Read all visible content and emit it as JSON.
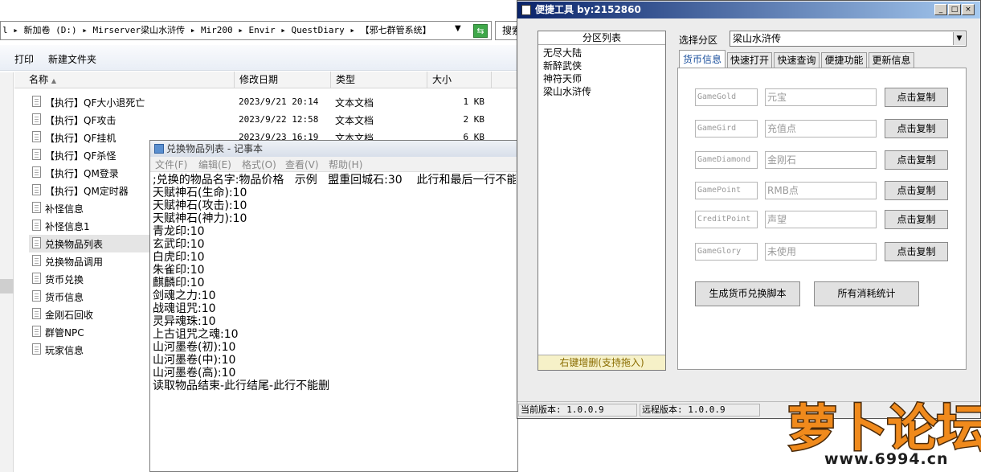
{
  "explorer": {
    "address": "l ▸ 新加卷 (D:) ▸ Mirserver梁山水浒传 ▸ Mir200 ▸ Envir ▸ QuestDiary ▸ 【邪七群管系统】",
    "search_label": "搜索",
    "toolbar": {
      "print": "打印",
      "new_folder": "新建文件夹"
    },
    "columns": {
      "name": "名称",
      "date": "修改日期",
      "type": "类型",
      "size": "大小"
    },
    "files": [
      {
        "name": "【执行】QF大小退死亡",
        "date": "2023/9/21 20:14",
        "type": "文本文档",
        "size": "1 KB"
      },
      {
        "name": "【执行】QF攻击",
        "date": "2023/9/22 12:58",
        "type": "文本文档",
        "size": "2 KB"
      },
      {
        "name": "【执行】QF挂机",
        "date": "2023/9/23 16:19",
        "type": "文本文档",
        "size": "6 KB"
      },
      {
        "name": "【执行】QF杀怪",
        "date": "",
        "type": "",
        "size": ""
      },
      {
        "name": "【执行】QM登录",
        "date": "",
        "type": "",
        "size": ""
      },
      {
        "name": "【执行】QM定时器",
        "date": "",
        "type": "",
        "size": ""
      },
      {
        "name": "补怪信息",
        "date": "",
        "type": "",
        "size": ""
      },
      {
        "name": "补怪信息1",
        "date": "",
        "type": "",
        "size": ""
      },
      {
        "name": "兑换物品列表",
        "date": "",
        "type": "",
        "size": ""
      },
      {
        "name": "兑换物品调用",
        "date": "",
        "type": "",
        "size": ""
      },
      {
        "name": "货币兑换",
        "date": "",
        "type": "",
        "size": ""
      },
      {
        "name": "货币信息",
        "date": "",
        "type": "",
        "size": ""
      },
      {
        "name": "金刚石回收",
        "date": "",
        "type": "",
        "size": ""
      },
      {
        "name": "群管NPC",
        "date": "",
        "type": "",
        "size": ""
      },
      {
        "name": "玩家信息",
        "date": "",
        "type": "",
        "size": ""
      }
    ]
  },
  "notepad": {
    "title": "兑换物品列表 - 记事本",
    "menu": [
      "文件(F)",
      "编辑(E)",
      "格式(O)",
      "查看(V)",
      "帮助(H)"
    ],
    "content": ";兑换的物品名字:物品价格   示例   盟重回城石:30    此行和最后一行不能删\n天赋神石(生命):10\n天赋神石(攻击):10\n天赋神石(神力):10\n青龙印:10\n玄武印:10\n白虎印:10\n朱雀印:10\n麒麟印:10\n剑魂之力:10\n战魂诅咒:10\n灵异魂珠:10\n上古诅咒之魂:10\n山河墨卷(初):10\n山河墨卷(中):10\n山河墨卷(高):10\n读取物品结束-此行结尾-此行不能删"
  },
  "tool": {
    "title": "便捷工具   by:2152860",
    "partition_list_header": "分区列表",
    "partitions": [
      "无尽大陆",
      "新醉武侠",
      "神符天师",
      "梁山水浒传"
    ],
    "partition_footer": "右键增删(支持拖入)",
    "select_label": "选择分区",
    "selected_partition": "梁山水浒传",
    "tabs": [
      "货币信息",
      "快速打开",
      "快速查询",
      "便捷功能",
      "更新信息"
    ],
    "currencies": [
      {
        "code": "GameGold",
        "name": "元宝",
        "button": "点击复制"
      },
      {
        "code": "GameGird",
        "name": "充值点",
        "button": "点击复制"
      },
      {
        "code": "GameDiamond",
        "name": "金刚石",
        "button": "点击复制"
      },
      {
        "code": "GamePoint",
        "name": "RMB点",
        "button": "点击复制"
      },
      {
        "code": "CreditPoint",
        "name": "声望",
        "button": "点击复制"
      },
      {
        "code": "GameGlory",
        "name": "未使用",
        "button": "点击复制"
      }
    ],
    "gen_script_button": "生成货币兑换脚本",
    "stats_button": "所有消耗统计",
    "status": {
      "current_version": "当前版本: 1.0.0.9",
      "remote_version": "远程版本: 1.0.0.9"
    }
  },
  "watermark": {
    "text": "萝卜论坛",
    "url": "www.6994.cn"
  },
  "colors": {
    "title_start": "#0a246a",
    "title_end": "#a6caf0",
    "tab_active": "#1a4f9c",
    "watermark_orange": "#f08a1c"
  }
}
